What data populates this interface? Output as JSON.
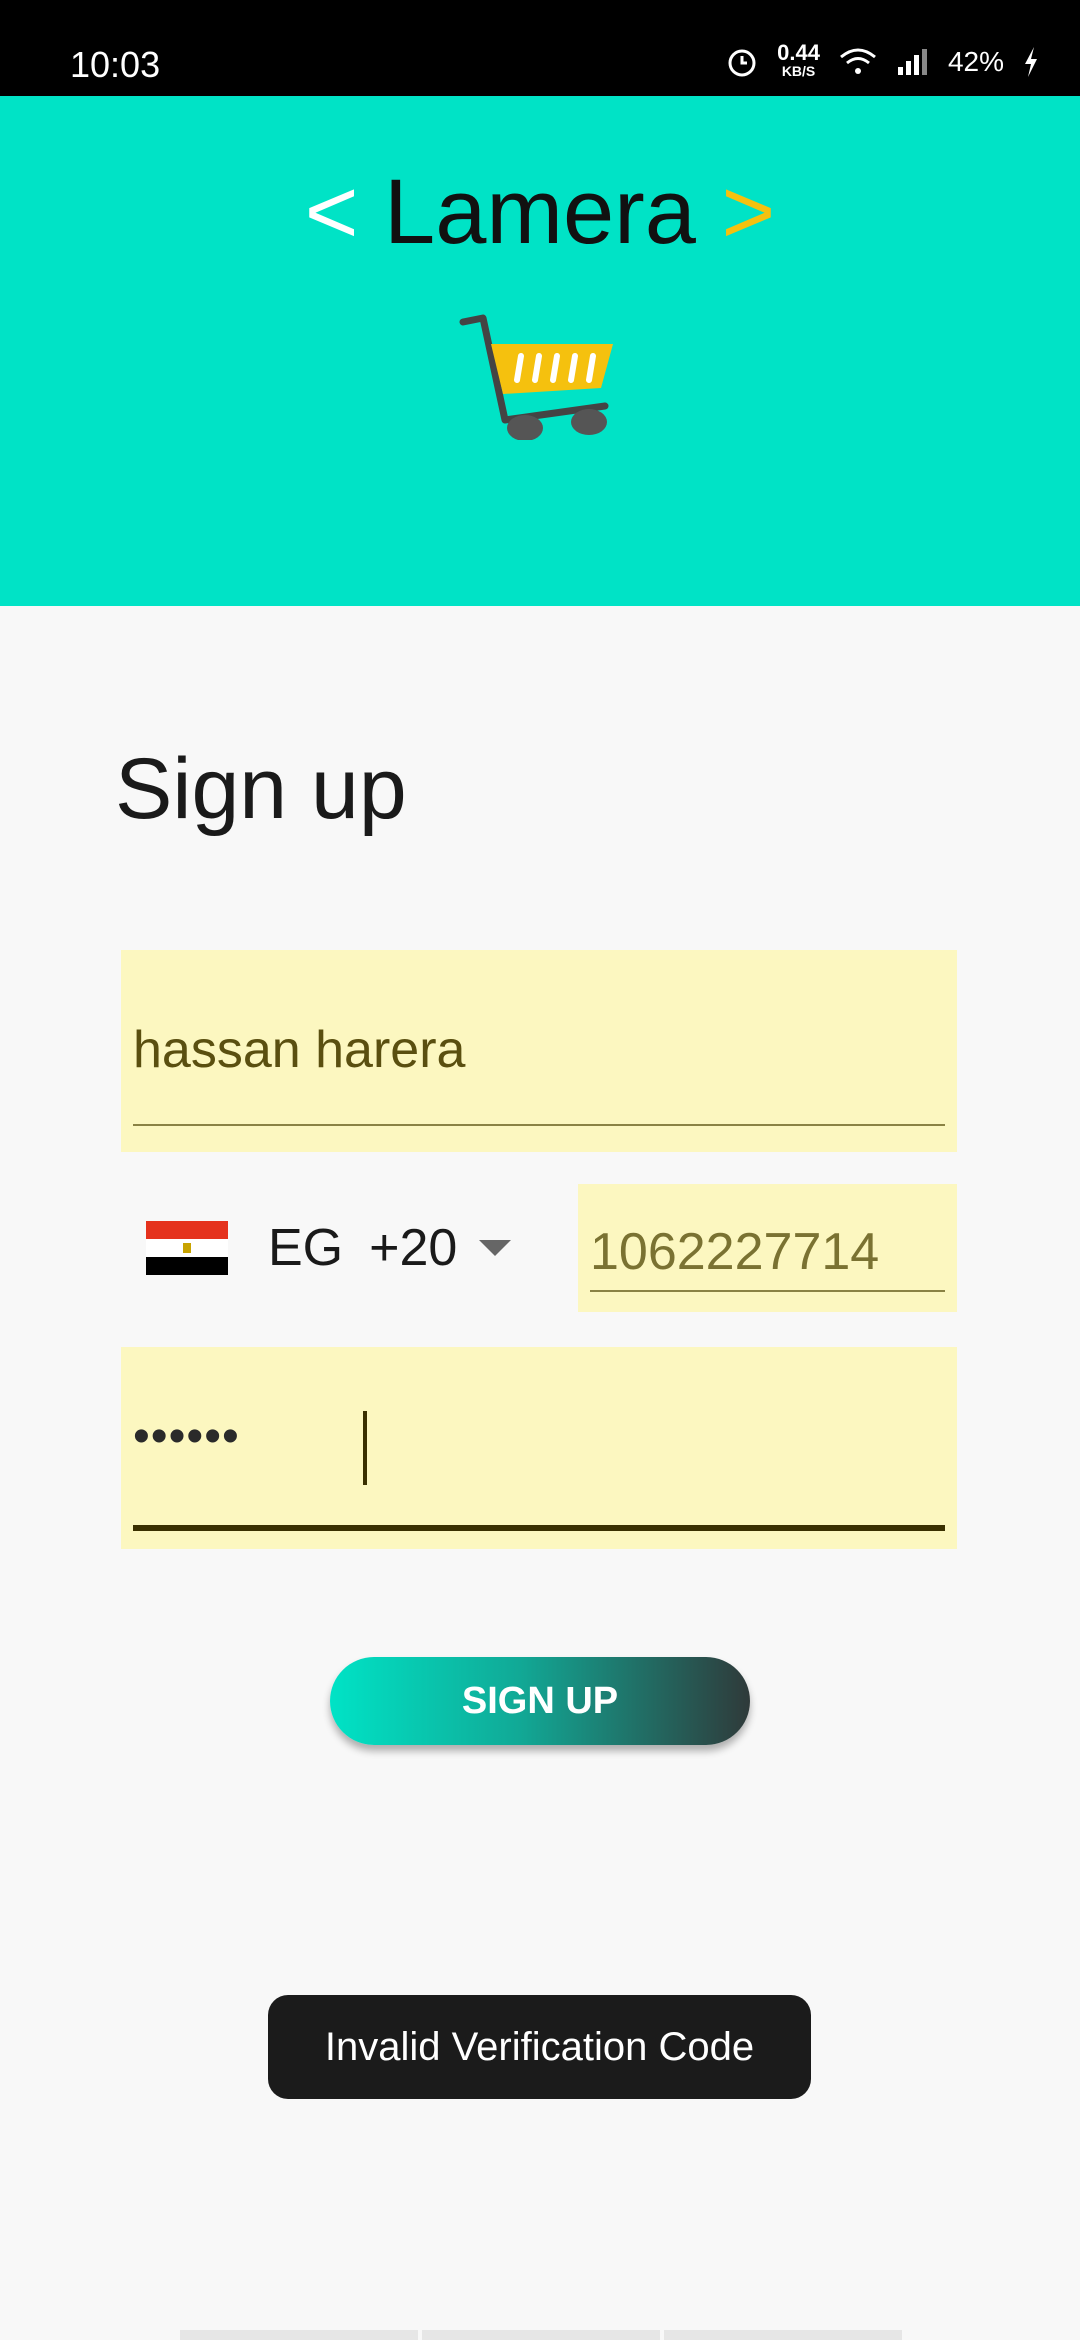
{
  "status_bar": {
    "time": "10:03",
    "speed_value": "0.44",
    "speed_unit": "KB/S",
    "battery": "42%"
  },
  "header": {
    "brand_left": "<",
    "brand_name": "Lamera",
    "brand_right": ">",
    "bg_color": "#00e3c6"
  },
  "form": {
    "title": "Sign up",
    "name_value": "hassan harera",
    "country_code": "EG",
    "dial_code": "+20",
    "phone_value": "1062227714",
    "password_mask": "••••••"
  },
  "signup_button": {
    "label": "SIGN UP"
  },
  "toast": {
    "message": "Invalid Verification Code"
  },
  "icons": [
    "alarm-icon",
    "wifi-icon",
    "signal-icon",
    "charging-icon",
    "cart-icon",
    "egypt-flag-icon",
    "dropdown-arrow-icon"
  ]
}
